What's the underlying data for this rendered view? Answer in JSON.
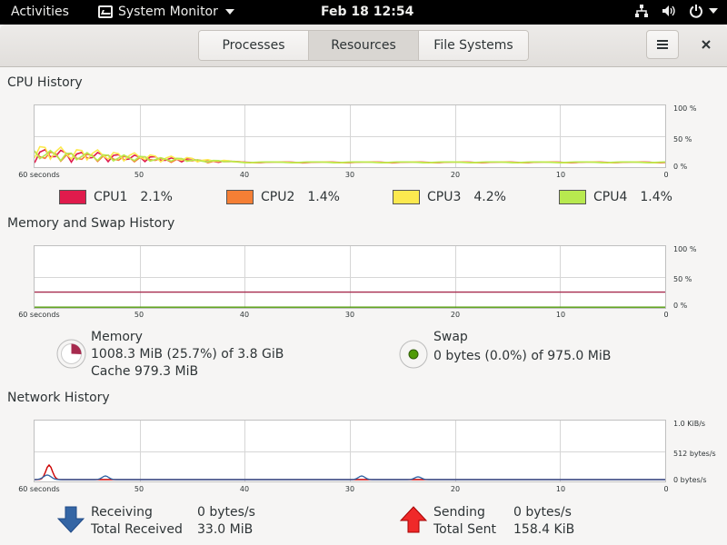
{
  "topbar": {
    "activities": "Activities",
    "app_name": "System Monitor",
    "clock": "Feb 18  12:54"
  },
  "tabs": [
    {
      "label": "Processes",
      "active": false
    },
    {
      "label": "Resources",
      "active": true
    },
    {
      "label": "File Systems",
      "active": false
    }
  ],
  "cpu": {
    "title": "CPU History",
    "y_labels": [
      "100 %",
      "50 %",
      "0 %"
    ],
    "x_labels": [
      "60 seconds",
      "50",
      "40",
      "30",
      "20",
      "10",
      "0"
    ],
    "legend": [
      {
        "name": "CPU1",
        "value": "2.1%",
        "color": "#e01b4c"
      },
      {
        "name": "CPU2",
        "value": "1.4%",
        "color": "#f57f35"
      },
      {
        "name": "CPU3",
        "value": "4.2%",
        "color": "#fce94f"
      },
      {
        "name": "CPU4",
        "value": "1.4%",
        "color": "#b8e94f"
      }
    ]
  },
  "memory": {
    "title": "Memory and Swap History",
    "y_labels": [
      "100 %",
      "50 %",
      "0 %"
    ],
    "x_labels": [
      "60 seconds",
      "50",
      "40",
      "30",
      "20",
      "10",
      "0"
    ],
    "memory_label": "Memory",
    "memory_value": "1008.3 MiB (25.7%) of 3.8 GiB",
    "cache_value": "Cache 979.3 MiB",
    "memory_color": "#a62a4e",
    "memory_percent": 25.7,
    "swap_label": "Swap",
    "swap_value": "0 bytes (0.0%) of 975.0 MiB",
    "swap_color": "#4e9a06",
    "swap_percent": 0.0
  },
  "network": {
    "title": "Network History",
    "y_labels": [
      "1.0 KiB/s",
      "512 bytes/s",
      "0 bytes/s"
    ],
    "x_labels": [
      "60 seconds",
      "50",
      "40",
      "30",
      "20",
      "10",
      "0"
    ],
    "receiving_label": "Receiving",
    "receiving_value": "0 bytes/s",
    "total_received_label": "Total Received",
    "total_received_value": "33.0 MiB",
    "sending_label": "Sending",
    "sending_value": "0 bytes/s",
    "total_sent_label": "Total Sent",
    "total_sent_value": "158.4 KiB",
    "receive_color": "#3465a4",
    "send_color": "#cc0000"
  }
}
